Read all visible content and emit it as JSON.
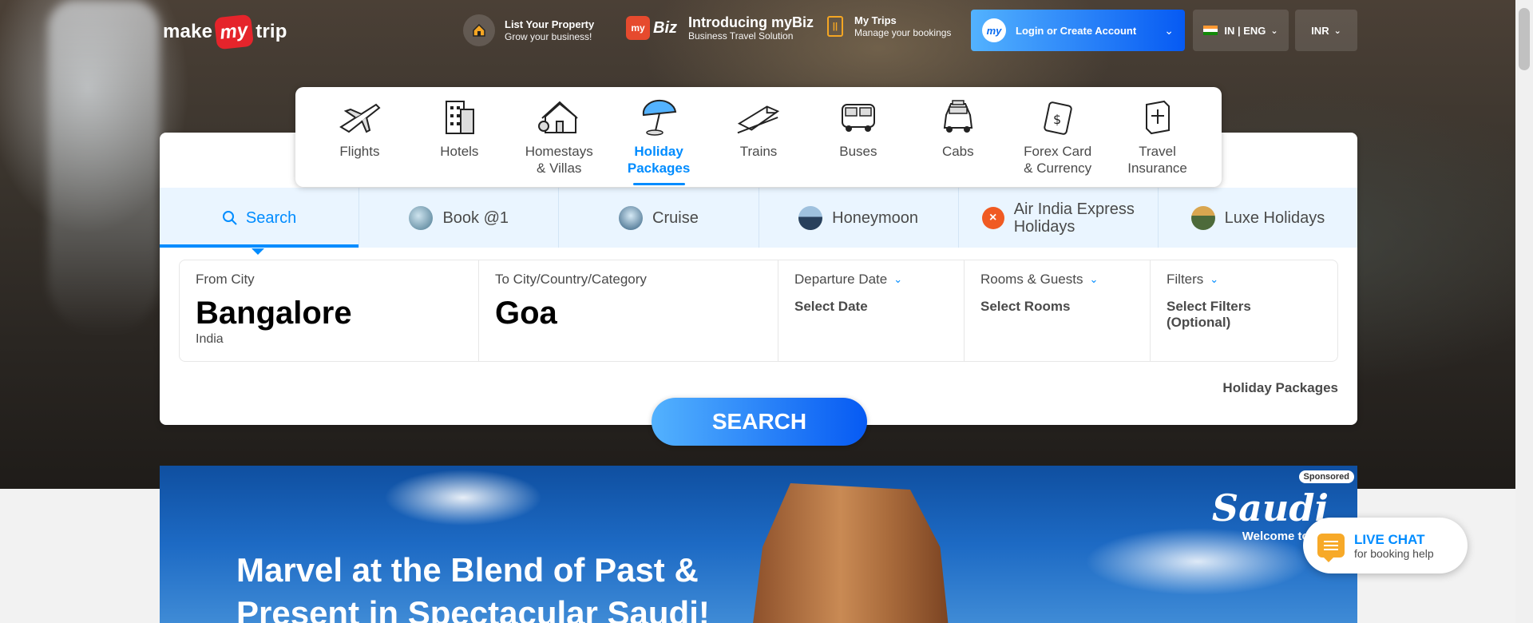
{
  "header": {
    "logo": {
      "part1": "make",
      "part2": "my",
      "part3": "trip"
    },
    "list_property": {
      "title": "List Your Property",
      "subtitle": "Grow your business!"
    },
    "mybiz": {
      "badge": "my",
      "word": "Biz",
      "title": "Introducing myBiz",
      "subtitle": "Business Travel Solution"
    },
    "my_trips": {
      "title": "My Trips",
      "subtitle": "Manage your bookings"
    },
    "login": {
      "label": "Login or Create Account",
      "avatar": "my"
    },
    "language": "IN | ENG",
    "currency": "INR"
  },
  "nav": {
    "items": [
      {
        "label": "Flights",
        "icon": "flight-icon"
      },
      {
        "label": "Hotels",
        "icon": "hotel-icon"
      },
      {
        "label": "Homestays\n& Villas",
        "icon": "homestay-icon"
      },
      {
        "label": "Holiday\nPackages",
        "icon": "holiday-icon",
        "active": true
      },
      {
        "label": "Trains",
        "icon": "train-icon"
      },
      {
        "label": "Buses",
        "icon": "bus-icon"
      },
      {
        "label": "Cabs",
        "icon": "cab-icon"
      },
      {
        "label": "Forex Card\n& Currency",
        "icon": "forex-icon"
      },
      {
        "label": "Travel\nInsurance",
        "icon": "insurance-icon"
      }
    ]
  },
  "subtabs": [
    {
      "label": "Search",
      "active": true
    },
    {
      "label": "Book @1"
    },
    {
      "label": "Cruise"
    },
    {
      "label": "Honeymoon"
    },
    {
      "label": "Air India Express\nHolidays"
    },
    {
      "label": "Luxe Holidays"
    }
  ],
  "search": {
    "from": {
      "label": "From City",
      "value": "Bangalore",
      "sub": "India"
    },
    "to": {
      "label": "To City/Country/Category",
      "value": "Goa"
    },
    "departure": {
      "label": "Departure Date",
      "value": "Select Date"
    },
    "rooms": {
      "label": "Rooms & Guests",
      "value": "Select Rooms"
    },
    "filters": {
      "label": "Filters",
      "value": "Select Filters\n(Optional)"
    },
    "link": "Holiday Packages",
    "button": "SEARCH"
  },
  "banner": {
    "title": "Marvel at the Blend of Past & Present in Spectacular Saudi!",
    "sponsored": "Sponsored",
    "brand": "Saudi",
    "brand_sub": "Welcome to Arabia"
  },
  "live_chat": {
    "title": "LIVE CHAT",
    "subtitle": "for booking help"
  },
  "colors": {
    "accent": "#008cff",
    "brand_red": "#e5242b",
    "gradient_start": "#53b2fe",
    "gradient_end": "#065af3"
  }
}
